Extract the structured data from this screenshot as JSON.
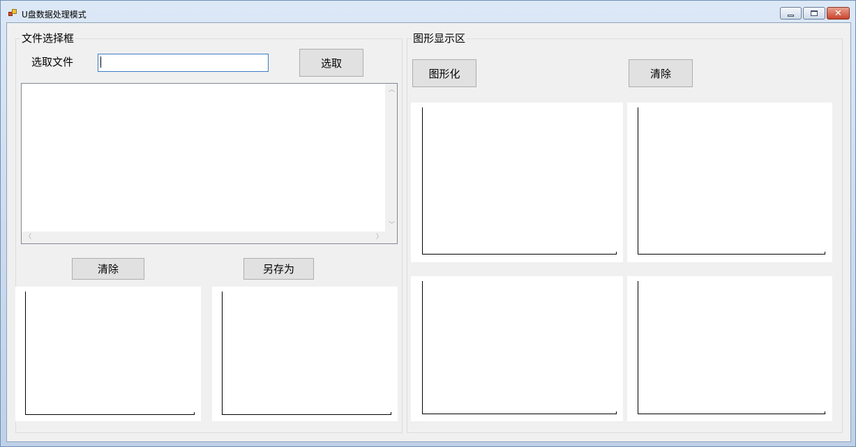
{
  "window": {
    "title": "U盘数据处理模式"
  },
  "file_group": {
    "title": "文件选择框",
    "select_label": "选取文件",
    "file_input_value": "",
    "select_button": "选取",
    "clear_button": "清除",
    "save_as_button": "另存为"
  },
  "graph_group": {
    "title": "图形显示区",
    "graph_button": "图形化",
    "clear_button": "清除"
  }
}
